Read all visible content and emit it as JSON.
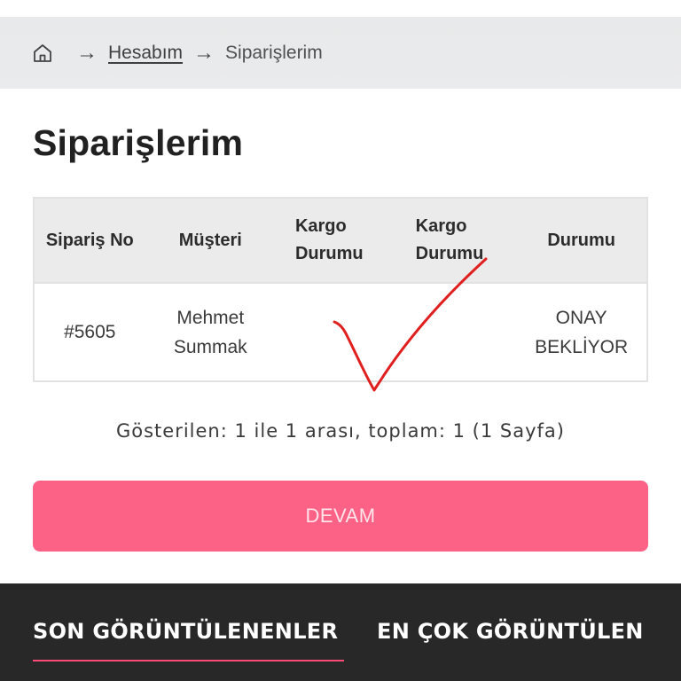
{
  "breadcrumb": {
    "home_icon": "home-icon",
    "separator": "→",
    "items": [
      {
        "label": "Hesabım"
      },
      {
        "label": "Siparişlerim"
      }
    ]
  },
  "page": {
    "title": "Siparişlerim"
  },
  "table": {
    "headers": {
      "order_no": "Sipariş No",
      "customer": "Müşteri",
      "cargo_status_1": "Kargo Durumu",
      "cargo_status_2": "Kargo Durumu",
      "status": "Durumu"
    },
    "rows": [
      {
        "order_no": "#5605",
        "customer": "Mehmet Summak",
        "cargo_status_1": "",
        "cargo_status_2": "",
        "status": "ONAY BEKLİYOR"
      }
    ]
  },
  "pagination": {
    "text": "Gösterilen: 1 ile 1 arası, toplam: 1 (1 Sayfa)"
  },
  "continue_button": {
    "label": "DEVAM"
  },
  "footer_tabs": {
    "recent": "SON GÖRÜNTÜLENENLER",
    "popular": "EN ÇOK GÖRÜNTÜLEN"
  },
  "colors": {
    "accent": "#fc6286",
    "footer_bg": "#282828",
    "check_mark": "#e01f1f"
  }
}
